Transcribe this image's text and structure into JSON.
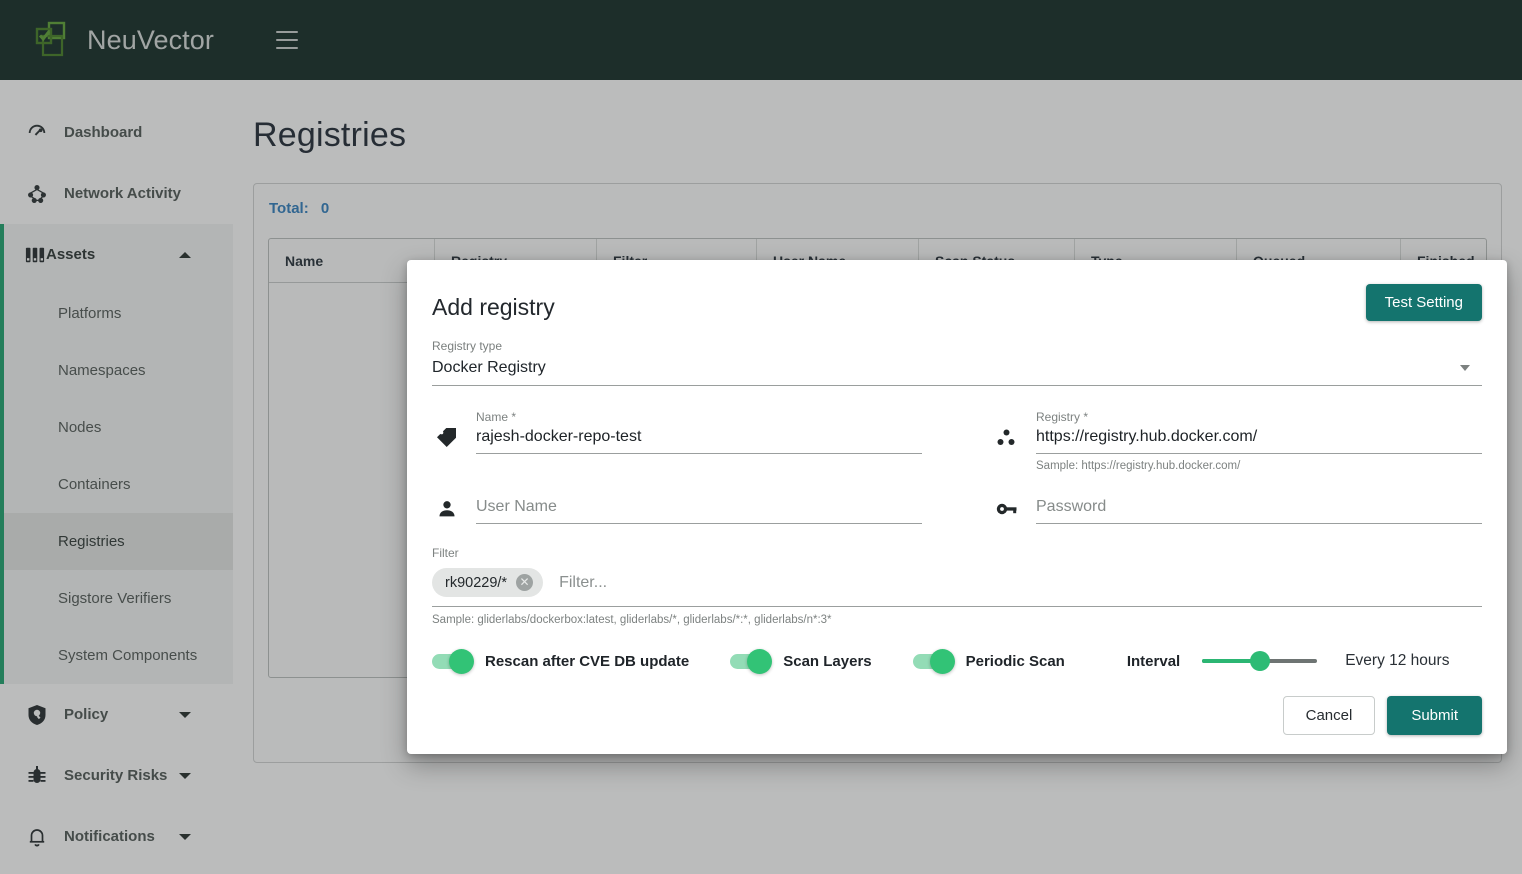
{
  "topbar": {
    "brand": "NeuVector",
    "menu_icon": "hamburger-icon"
  },
  "sidebar": {
    "items": [
      {
        "label": "Dashboard",
        "icon": "speedometer-icon",
        "type": "item"
      },
      {
        "label": "Network Activity",
        "icon": "network-graph-icon",
        "type": "item"
      }
    ],
    "assets_group": {
      "label": "Assets",
      "icon": "assets-icon",
      "expanded": true,
      "caret": "chevron-up-icon",
      "children": [
        {
          "label": "Platforms",
          "selected": false
        },
        {
          "label": "Namespaces",
          "selected": false
        },
        {
          "label": "Nodes",
          "selected": false
        },
        {
          "label": "Containers",
          "selected": false
        },
        {
          "label": "Registries",
          "selected": true
        },
        {
          "label": "Sigstore Verifiers",
          "selected": false
        },
        {
          "label": "System Components",
          "selected": false
        }
      ]
    },
    "bottom_items": [
      {
        "label": "Policy",
        "icon": "shield-icon",
        "caret": "chevron-down-icon"
      },
      {
        "label": "Security Risks",
        "icon": "bug-icon",
        "caret": "chevron-down-icon"
      },
      {
        "label": "Notifications",
        "icon": "bell-icon",
        "caret": "chevron-down-icon"
      }
    ]
  },
  "page": {
    "title": "Registries",
    "total_label": "Total:",
    "total_value": "0",
    "table_headers": [
      "Name",
      "Registry",
      "Filter",
      "User Name",
      "Scan Status",
      "Type",
      "Queued",
      "Finished"
    ]
  },
  "modal": {
    "title": "Add registry",
    "test_setting_label": "Test Setting",
    "registry_type": {
      "label": "Registry type",
      "value": "Docker Registry",
      "caret": "chevron-down-icon"
    },
    "name_field": {
      "label": "Name *",
      "value": "rajesh-docker-repo-test",
      "icon": "tag-icon"
    },
    "registry_field": {
      "label": "Registry *",
      "value": "https://registry.hub.docker.com/",
      "hint": "Sample: https://registry.hub.docker.com/",
      "icon": "hub-dots-icon"
    },
    "username_field": {
      "placeholder": "User Name",
      "value": "",
      "icon": "person-icon"
    },
    "password_field": {
      "placeholder": "Password",
      "value": "",
      "icon": "key-icon"
    },
    "filter": {
      "label": "Filter",
      "chips": [
        "rk90229/*"
      ],
      "chip_remove_icon": "close-circle-icon",
      "placeholder": "Filter...",
      "hint": "Sample: gliderlabs/dockerbox:latest, gliderlabs/*, gliderlabs/*:*, gliderlabs/n*:3*"
    },
    "toggles": [
      {
        "label": "Rescan after CVE DB update",
        "on": true
      },
      {
        "label": "Scan Layers",
        "on": true
      },
      {
        "label": "Periodic Scan",
        "on": true
      }
    ],
    "interval": {
      "label": "Interval",
      "value_text": "Every 12 hours",
      "percent": 50
    },
    "cancel_label": "Cancel",
    "submit_label": "Submit"
  },
  "colors": {
    "brand_dark": "#0d2620",
    "teal_button": "#14746e",
    "toggle_green": "#32c376",
    "slider_green": "#2bb673",
    "total_blue": "#2b7bbd",
    "active_green": "#18a06a"
  }
}
